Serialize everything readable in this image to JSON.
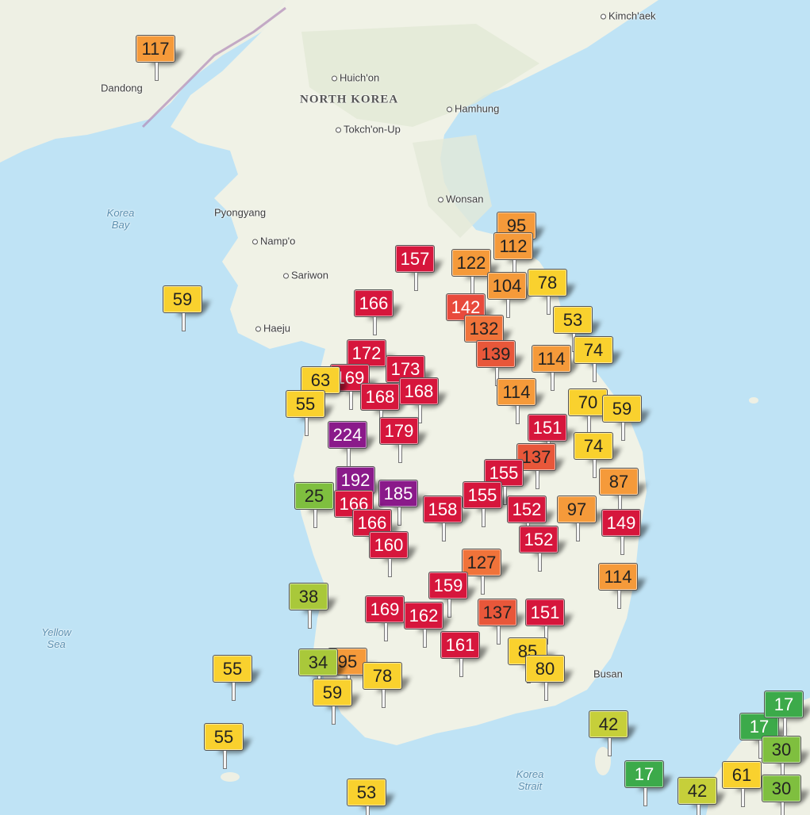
{
  "places": [
    {
      "name": "Kimch'aek",
      "kind": "city"
    },
    {
      "name": "Huich'on",
      "kind": "city"
    },
    {
      "name": "NORTH KOREA",
      "kind": "country"
    },
    {
      "name": "Dandong",
      "kind": "city"
    },
    {
      "name": "Hamhung",
      "kind": "city"
    },
    {
      "name": "Tokch'on-Up",
      "kind": "city"
    },
    {
      "name": "Wonsan",
      "kind": "city"
    },
    {
      "name": "Pyongyang",
      "kind": "city"
    },
    {
      "name": "Namp'o",
      "kind": "city"
    },
    {
      "name": "Sariwon",
      "kind": "city"
    },
    {
      "name": "Haeju",
      "kind": "city"
    },
    {
      "name": "Busan",
      "kind": "city"
    },
    {
      "name": "Korea\nBay",
      "kind": "water"
    },
    {
      "name": "Yellow\nSea",
      "kind": "water"
    },
    {
      "name": "Korea\nStrait",
      "kind": "water"
    }
  ],
  "aqi_markers": [
    {
      "value": "117",
      "color": "#f59a3a"
    },
    {
      "value": "95",
      "color": "#f59a3a"
    },
    {
      "value": "112",
      "color": "#f59a3a"
    },
    {
      "value": "122",
      "color": "#f59a3a"
    },
    {
      "value": "157",
      "color": "#d6163c"
    },
    {
      "value": "104",
      "color": "#f59a3a"
    },
    {
      "value": "78",
      "color": "#f9d12e"
    },
    {
      "value": "59",
      "color": "#f9d12e"
    },
    {
      "value": "166",
      "color": "#d6163c"
    },
    {
      "value": "142",
      "color": "#e84a3c"
    },
    {
      "value": "53",
      "color": "#f9d12e"
    },
    {
      "value": "132",
      "color": "#f0733a"
    },
    {
      "value": "172",
      "color": "#d6163c"
    },
    {
      "value": "139",
      "color": "#e8573a"
    },
    {
      "value": "114",
      "color": "#f59a3a"
    },
    {
      "value": "74",
      "color": "#f9d12e"
    },
    {
      "value": "173",
      "color": "#d6163c"
    },
    {
      "value": "169",
      "color": "#d6163c"
    },
    {
      "value": "63",
      "color": "#f9d12e"
    },
    {
      "value": "168",
      "color": "#d6163c"
    },
    {
      "value": "168",
      "color": "#d6163c"
    },
    {
      "value": "114",
      "color": "#f59a3a"
    },
    {
      "value": "70",
      "color": "#f9d12e"
    },
    {
      "value": "59",
      "color": "#f9d12e"
    },
    {
      "value": "55",
      "color": "#f9d12e"
    },
    {
      "value": "224",
      "color": "#8a1a8a"
    },
    {
      "value": "179",
      "color": "#d6163c"
    },
    {
      "value": "151",
      "color": "#d6163c"
    },
    {
      "value": "74",
      "color": "#f9d12e"
    },
    {
      "value": "137",
      "color": "#e8573a"
    },
    {
      "value": "155",
      "color": "#d6163c"
    },
    {
      "value": "192",
      "color": "#8a1a8a"
    },
    {
      "value": "87",
      "color": "#f59a3a"
    },
    {
      "value": "25",
      "color": "#7fbf3f"
    },
    {
      "value": "185",
      "color": "#8a1a8a"
    },
    {
      "value": "155",
      "color": "#d6163c"
    },
    {
      "value": "166",
      "color": "#d6163c"
    },
    {
      "value": "158",
      "color": "#d6163c"
    },
    {
      "value": "152",
      "color": "#d6163c"
    },
    {
      "value": "97",
      "color": "#f59a3a"
    },
    {
      "value": "149",
      "color": "#d6163c"
    },
    {
      "value": "166",
      "color": "#d6163c"
    },
    {
      "value": "160",
      "color": "#d6163c"
    },
    {
      "value": "152",
      "color": "#d6163c"
    },
    {
      "value": "127",
      "color": "#f0733a"
    },
    {
      "value": "114",
      "color": "#f59a3a"
    },
    {
      "value": "38",
      "color": "#a9c83a"
    },
    {
      "value": "159",
      "color": "#d6163c"
    },
    {
      "value": "169",
      "color": "#d6163c"
    },
    {
      "value": "162",
      "color": "#d6163c"
    },
    {
      "value": "137",
      "color": "#e8573a"
    },
    {
      "value": "151",
      "color": "#d6163c"
    },
    {
      "value": "161",
      "color": "#d6163c"
    },
    {
      "value": "95",
      "color": "#f59a3a"
    },
    {
      "value": "34",
      "color": "#a9c83a"
    },
    {
      "value": "85",
      "color": "#f9d12e"
    },
    {
      "value": "80",
      "color": "#f9d12e"
    },
    {
      "value": "78",
      "color": "#f9d12e"
    },
    {
      "value": "59",
      "color": "#f9d12e"
    },
    {
      "value": "55",
      "color": "#f9d12e"
    },
    {
      "value": "55",
      "color": "#f9d12e"
    },
    {
      "value": "42",
      "color": "#c6cf3a"
    },
    {
      "value": "17",
      "color": "#3caa4a"
    },
    {
      "value": "17",
      "color": "#3caa4a"
    },
    {
      "value": "30",
      "color": "#7fbf3f"
    },
    {
      "value": "17",
      "color": "#3caa4a"
    },
    {
      "value": "61",
      "color": "#f9d12e"
    },
    {
      "value": "42",
      "color": "#c6cf3a"
    },
    {
      "value": "30",
      "color": "#7fbf3f"
    },
    {
      "value": "53",
      "color": "#f9d12e"
    }
  ]
}
